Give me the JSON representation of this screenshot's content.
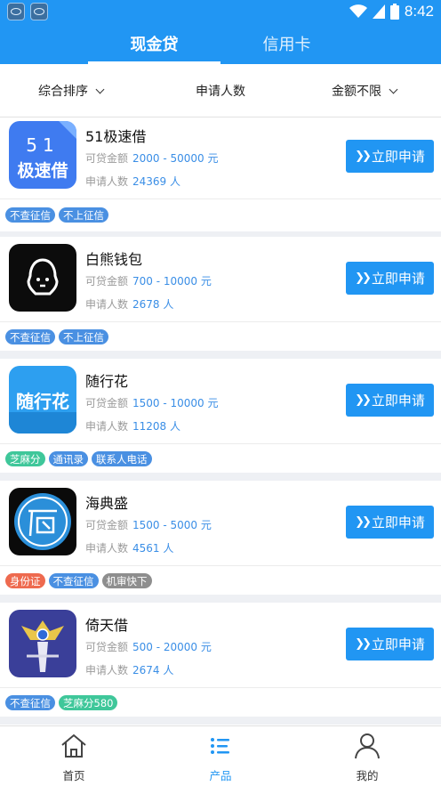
{
  "status": {
    "time": "8:42"
  },
  "tabs": [
    {
      "label": "现金贷",
      "active": true
    },
    {
      "label": "信用卡",
      "active": false
    }
  ],
  "filters": [
    {
      "label": "综合排序",
      "has_dropdown": true
    },
    {
      "label": "申请人数",
      "has_dropdown": false
    },
    {
      "label": "金额不限",
      "has_dropdown": true
    }
  ],
  "labels": {
    "amount": "可贷金额",
    "applicants": "申请人数",
    "apply": "立即申请"
  },
  "products": [
    {
      "name": "51极速借",
      "amount": "2000 - 50000 元",
      "applicants": "24369 人",
      "logo": {
        "icon": "51-speed-loan-logo",
        "text_top": "51",
        "text_bottom": "极速借",
        "bg": "#3f7bf0"
      },
      "tags": [
        {
          "label": "不查征信",
          "color": "#4a90e2"
        },
        {
          "label": "不上征信",
          "color": "#4a90e2"
        }
      ]
    },
    {
      "name": "白熊钱包",
      "amount": "700 - 10000 元",
      "applicants": "2678 人",
      "logo": {
        "icon": "white-bear-logo",
        "bg": "#0c0c0c"
      },
      "tags": [
        {
          "label": "不查征信",
          "color": "#4a90e2"
        },
        {
          "label": "不上征信",
          "color": "#4a90e2"
        }
      ]
    },
    {
      "name": "随行花",
      "amount": "1500 - 10000 元",
      "applicants": "11208 人",
      "logo": {
        "icon": "suixinghua-logo",
        "text": "随行花",
        "bg": "#2d9ff0"
      },
      "tags": [
        {
          "label": "芝麻分",
          "color": "#3fc79a"
        },
        {
          "label": "通讯录",
          "color": "#4a90e2"
        },
        {
          "label": "联系人电话",
          "color": "#4a90e2"
        }
      ]
    },
    {
      "name": "海典盛",
      "amount": "1500 - 5000 元",
      "applicants": "4561 人",
      "logo": {
        "icon": "haidiansheng-logo",
        "bg": "#0a0a0a"
      },
      "tags": [
        {
          "label": "身份证",
          "color": "#ee6a4f"
        },
        {
          "label": "不查征信",
          "color": "#4a90e2"
        },
        {
          "label": "机审快下",
          "color": "#8e8e8e"
        }
      ]
    },
    {
      "name": "倚天借",
      "amount": "500 - 20000 元",
      "applicants": "2674 人",
      "logo": {
        "icon": "yitianjie-sword-logo",
        "bg": "#3a3f99"
      },
      "tags": [
        {
          "label": "不查征信",
          "color": "#4a90e2"
        },
        {
          "label": "芝麻分580",
          "color": "#3fc79a"
        }
      ]
    }
  ],
  "bottom_nav": [
    {
      "label": "首页",
      "icon": "home-icon",
      "active": false
    },
    {
      "label": "产品",
      "icon": "list-icon",
      "active": true
    },
    {
      "label": "我的",
      "icon": "user-icon",
      "active": false
    }
  ],
  "colors": {
    "primary": "#2196f3",
    "value_text": "#3a8ee6"
  }
}
